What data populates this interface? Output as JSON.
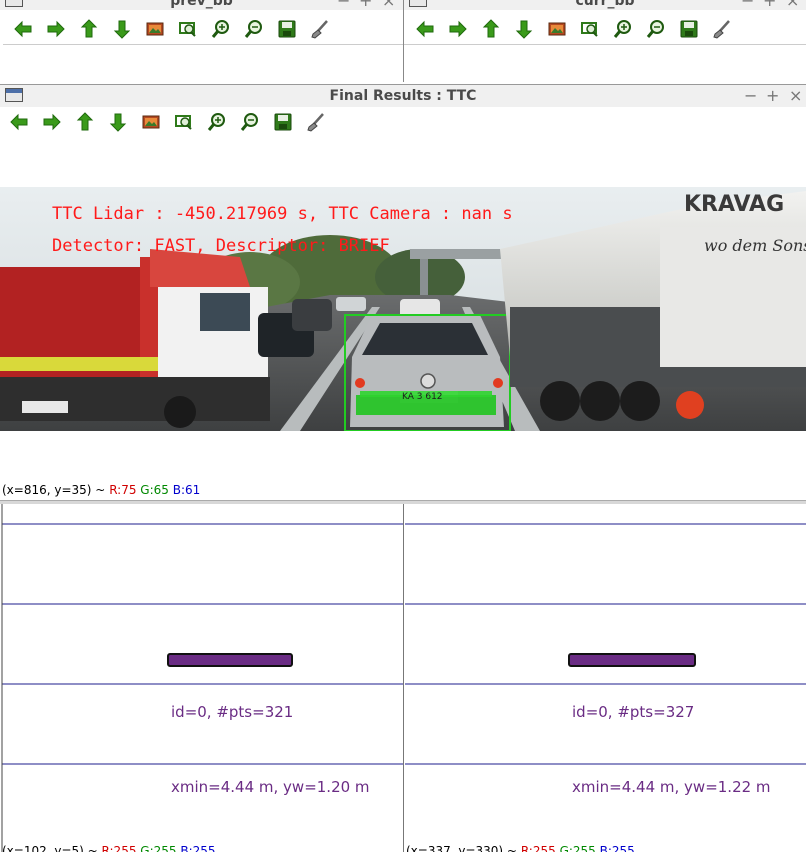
{
  "colors": {
    "accent_green": "#2e8b00",
    "marker_line": "#1c1c8c",
    "overlay_text": "#ff1a1a",
    "box_green": "#22cc22",
    "lidar_purple": "#6a2c84"
  },
  "toolbar_icons": [
    "arrow-left-icon",
    "arrow-right-icon",
    "arrow-up-icon",
    "arrow-down-icon",
    "image-icon",
    "zoom-fit-icon",
    "zoom-in-icon",
    "zoom-out-icon",
    "save-icon",
    "brush-icon"
  ],
  "windows": {
    "prev": {
      "title": "prev_bb"
    },
    "curr": {
      "title": "curr_bb"
    },
    "final": {
      "title": "Final Results : TTC",
      "overlay_line1": "TTC Lidar : -450.217969 s, TTC Camera : nan s",
      "overlay_line2": "Detector: FAST, Descriptor: BRIEF",
      "plate_text": "KA 3 612",
      "status_coords": "(x=816, y=35) ~",
      "status_r": "R:75",
      "status_g": "G:65",
      "status_b": "B:61"
    }
  },
  "topview": {
    "left": {
      "label_id": "id=0, #pts=321",
      "label_x": "xmin=4.44 m, yw=1.20 m",
      "status_coords": "(x=102, y=5) ~",
      "status_r": "R:255",
      "status_g": "G:255",
      "status_b": "B:255"
    },
    "right": {
      "label_id": "id=0, #pts=327",
      "label_x": "xmin=4.44 m, yw=1.22 m",
      "status_coords": "(x=337, y=330) ~",
      "status_r": "R:255",
      "status_g": "G:255",
      "status_b": "B:255"
    }
  },
  "controls": {
    "minimize": "−",
    "maximize": "+",
    "close": "×"
  }
}
